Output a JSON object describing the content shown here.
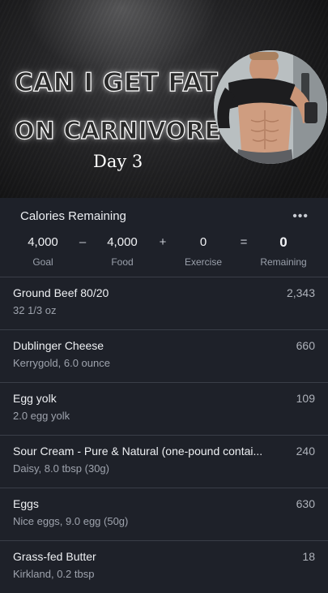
{
  "hero": {
    "headline_line1": "CAN I GET FAT",
    "headline_line2": "ON CARNIVORE?",
    "day_label": "Day 3"
  },
  "summary": {
    "title": "Calories Remaining",
    "more_icon": "more-horizontal-icon",
    "goal_value": "4,000",
    "goal_label": "Goal",
    "minus": "–",
    "food_value": "4,000",
    "food_label": "Food",
    "plus": "+",
    "exercise_value": "0",
    "exercise_label": "Exercise",
    "equals": "=",
    "remaining_value": "0",
    "remaining_label": "Remaining"
  },
  "foods": [
    {
      "name": "Ground Beef 80/20",
      "detail": "32 1/3 oz",
      "calories": "2,343"
    },
    {
      "name": "Dublinger Cheese",
      "detail": "Kerrygold, 6.0 ounce",
      "calories": "660"
    },
    {
      "name": "Egg yolk",
      "detail": "2.0 egg yolk",
      "calories": "109"
    },
    {
      "name": "Sour Cream - Pure & Natural (one-pound contai...",
      "detail": "Daisy, 8.0 tbsp (30g)",
      "calories": "240"
    },
    {
      "name": "Eggs",
      "detail": "Nice eggs, 9.0 egg (50g)",
      "calories": "630"
    },
    {
      "name": "Grass-fed Butter",
      "detail": "Kirkland, 0.2 tbsp",
      "calories": "18"
    }
  ],
  "colors": {
    "background": "#1e2129",
    "divider": "#3a3e48",
    "secondary_text": "#9ea3ad"
  }
}
